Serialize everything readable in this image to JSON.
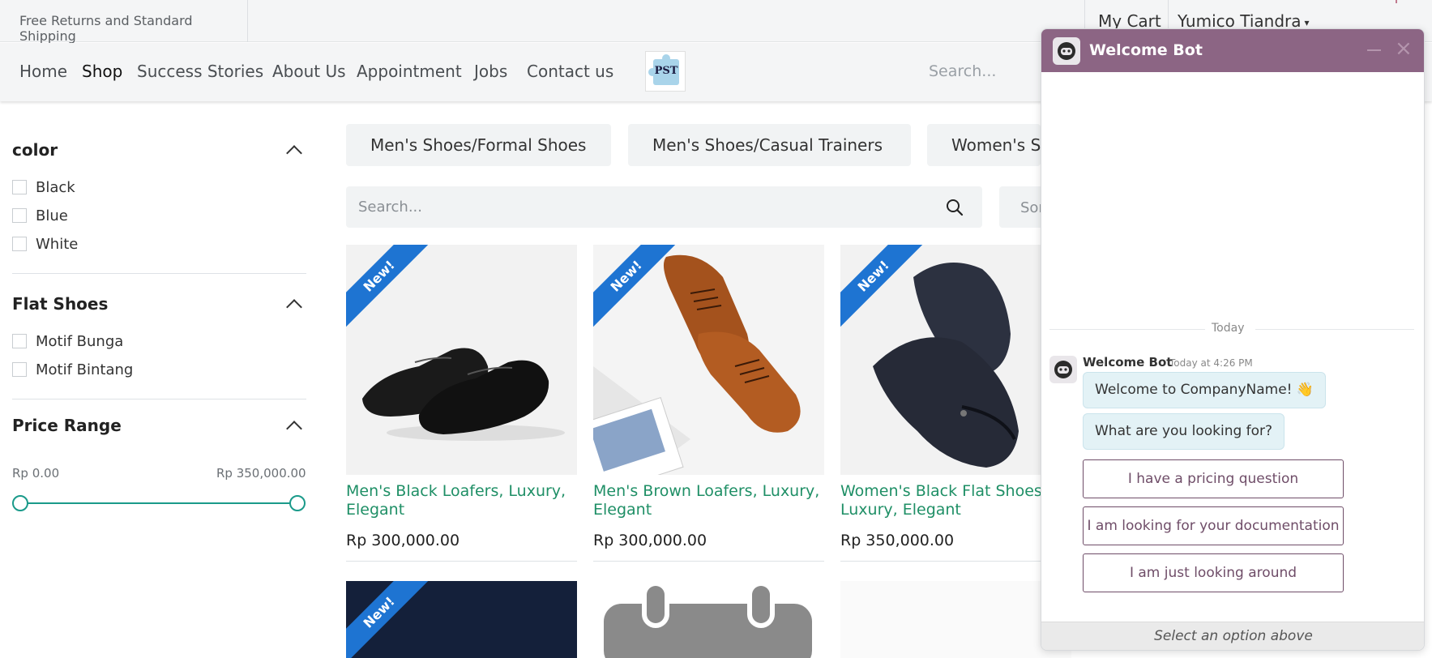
{
  "topbar": {
    "promo": "Free Returns and Standard Shipping",
    "cart": "My Cart",
    "user": "Yumico Tiandra",
    "caret": "▾"
  },
  "nav": {
    "links": [
      "Home",
      "Shop",
      "Success Stories",
      "About Us",
      "Appointment",
      "Jobs",
      "Contact us"
    ],
    "active": "Shop",
    "logo_text": "PST",
    "search_placeholder": "Search..."
  },
  "filters": {
    "color": {
      "title": "color",
      "options": [
        "Black",
        "Blue",
        "White"
      ]
    },
    "flat_shoes": {
      "title": "Flat Shoes",
      "options": [
        "Motif Bunga",
        "Motif Bintang"
      ]
    },
    "price_range": {
      "title": "Price Range",
      "min": "Rp 0.00",
      "max": "Rp 350,000.00"
    }
  },
  "categories": [
    "Men's Shoes/Formal Shoes",
    "Men's Shoes/Casual Trainers",
    "Women's Shoes"
  ],
  "shop_search": {
    "placeholder": "Search...",
    "sort_label": "Sort"
  },
  "products": [
    {
      "badge": "New!",
      "name": "Men's Black Loafers, Luxury, Elegant",
      "price": "Rp 300,000.00"
    },
    {
      "badge": "New!",
      "name": "Men's Brown Loafers, Luxury, Elegant",
      "price": "Rp 300,000.00"
    },
    {
      "badge": "New!",
      "name": "Women's Black Flat Shoes, Luxury, Elegant",
      "price": "Rp 350,000.00"
    },
    {
      "badge": "New!"
    }
  ],
  "chat": {
    "title": "Welcome Bot",
    "day": "Today",
    "sender": "Welcome Bot",
    "time": "Today at 4:26 PM",
    "messages": [
      "Welcome to CompanyName! 👋",
      "What are you looking for?"
    ],
    "options": [
      "I have a pricing question",
      "I am looking for your documentation",
      "I am just looking around"
    ],
    "footer": "Select an option above"
  },
  "colors": {
    "accent_green": "#1f8f66",
    "badge_blue": "#1e74d2",
    "chat_header": "#8c6584",
    "slider": "#1a9a8a"
  }
}
